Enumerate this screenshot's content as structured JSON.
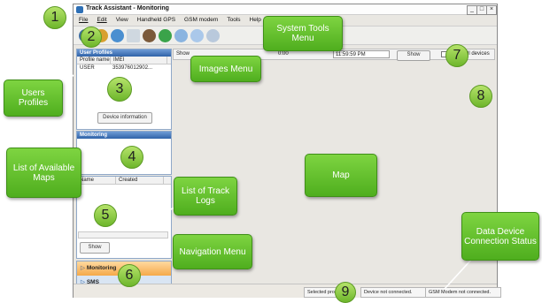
{
  "window": {
    "title": "Track Assistant - Monitoring",
    "minimize": "_",
    "maximize": "□",
    "close": "×"
  },
  "menu": [
    "File",
    "Edit",
    "View",
    "Handheld GPS",
    "GSM modem",
    "Tools",
    "Help"
  ],
  "user_profiles": {
    "header": "User Profiles",
    "columns": [
      "Profile name",
      "IMEI"
    ],
    "rows": [
      {
        "name": "USER",
        "imei": "353976012902..."
      }
    ],
    "device_info_button": "Device information"
  },
  "monitoring": {
    "header": "Monitoring"
  },
  "track_logs": {
    "columns": [
      "Name",
      "Created"
    ],
    "show_button": "Show"
  },
  "navigation": {
    "items": [
      {
        "label": "Monitoring",
        "active": true
      },
      {
        "label": "SMS",
        "active": false
      }
    ]
  },
  "map_toolbar": {
    "prefix": "Show",
    "time_from": "0:00",
    "time_to": "11:59:59 PM",
    "show_button": "Show",
    "checkbox_label": "Show all devices"
  },
  "status_bar": {
    "selected": "Selected pro",
    "device": "Device not connected.",
    "gsm": "GSM Modem not connected."
  },
  "annotations": {
    "numbers": [
      "1",
      "2",
      "3",
      "4",
      "5",
      "6",
      "7",
      "8",
      "9"
    ],
    "labels": {
      "system_tools_menu": "System Tools Menu",
      "images_menu": "Images Menu",
      "users_profiles": "Users Profiles",
      "list_of_maps": "List of Available Maps",
      "list_of_track_logs": "List of Track Logs",
      "navigation_menu": "Navigation Menu",
      "map": "Map",
      "data_device_status": "Data Device Connection Status"
    },
    "colors": {
      "fill": "#5cb828",
      "border": "#3f8f18",
      "number_fill": "#9bd34f"
    }
  }
}
